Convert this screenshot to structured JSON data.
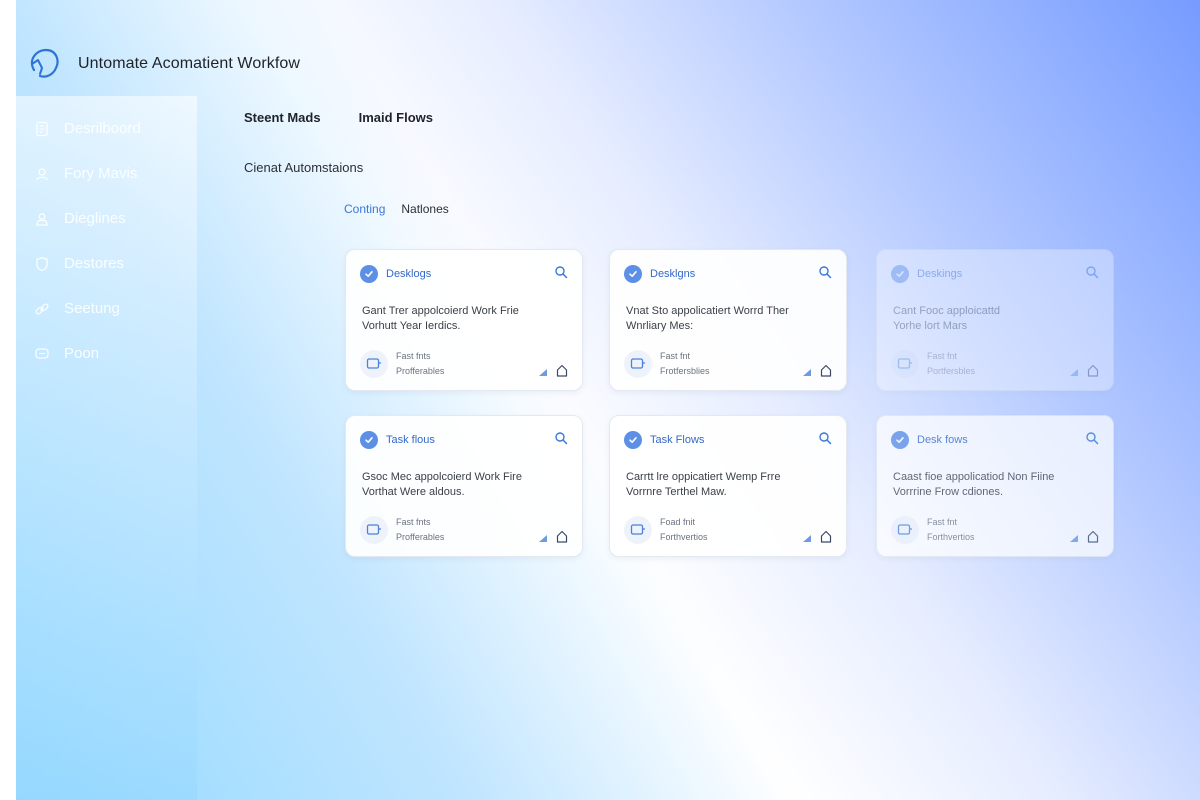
{
  "app": {
    "title": "Untomate Acomatient Workfow"
  },
  "sidebar": {
    "items": [
      {
        "label": "Desrilboord",
        "icon": "document-icon"
      },
      {
        "label": "Fory Mavis",
        "icon": "user-icon"
      },
      {
        "label": "Dieglines",
        "icon": "people-icon"
      },
      {
        "label": "Destores",
        "icon": "shield-icon"
      },
      {
        "label": "Seetung",
        "icon": "link-icon"
      },
      {
        "label": "Poon",
        "icon": "chat-icon"
      }
    ]
  },
  "tabs": [
    {
      "label": "Steent Mads"
    },
    {
      "label": "Imaid Flows"
    }
  ],
  "section": {
    "title": "Cienat Automstaions"
  },
  "filters": [
    {
      "label": "Conting",
      "active": true
    },
    {
      "label": "Natlones",
      "active": false
    }
  ],
  "cards": [
    {
      "title": "Desklogs",
      "line1": "Gant Trer appolcoierd Work Frie",
      "line2": "Vorhutt Year Ierdics.",
      "meta1": "Fast fnts",
      "meta2": "Profferables"
    },
    {
      "title": "Desklgns",
      "line1": "Vnat Sto appolicatiert Worrd Ther",
      "line2": "Wnrliary Mes:",
      "meta1": "Fast fnt",
      "meta2": "Frotfersblies"
    },
    {
      "title": "Deskings",
      "line1": "Cant Fooc apploicattd",
      "line2": "Yorhe lort Mars",
      "meta1": "Fast fnt",
      "meta2": "Portfersbles"
    },
    {
      "title": "Task flous",
      "line1": "Gsoc Mec appolcoierd Work Fire",
      "line2": "Vorthat Were aldous.",
      "meta1": "Fast fnts",
      "meta2": "Profferables"
    },
    {
      "title": "Task Flows",
      "line1": "Carrtt lre oppicatiert Wemp Frre",
      "line2": "Vorrnre Terthel Maw.",
      "meta1": "Foad fnit",
      "meta2": "Forthvertios"
    },
    {
      "title": "Desk fows",
      "line1": "Caast fioe appolicatiod Non Fiine",
      "line2": "Vorrrine Frow cdiones.",
      "meta1": "Fast fnt",
      "meta2": "Forthvertios"
    }
  ],
  "colors": {
    "accent": "#3a78d8",
    "check": "#5c8fe6",
    "text": "#2b2f36"
  }
}
